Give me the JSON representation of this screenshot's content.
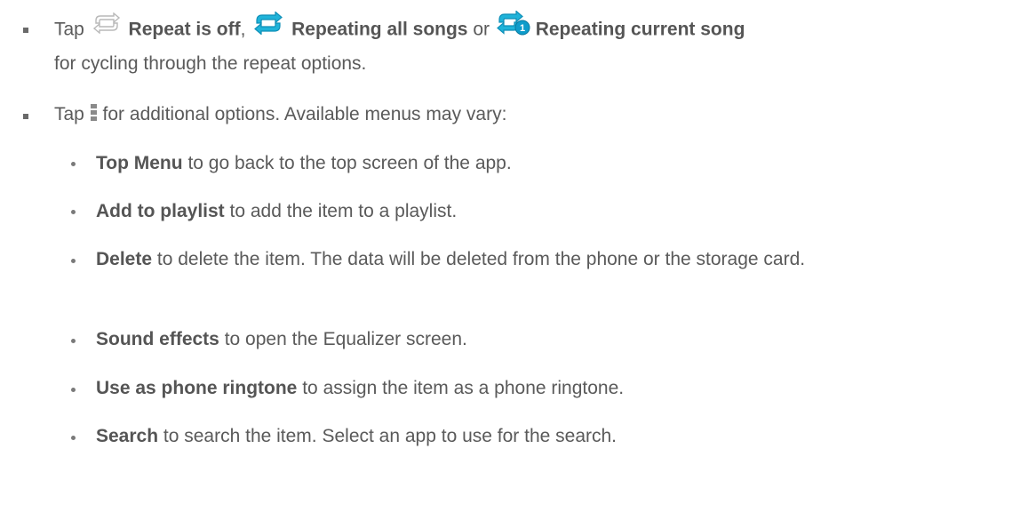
{
  "repeat_item": {
    "tap": "Tap",
    "off_label": "Repeat is off",
    "comma": ",",
    "all_label": "Repeating all songs",
    "or": "or",
    "current_label": "Repeating current song",
    "suffix": "for cycling through the repeat options.",
    "icons": {
      "off": "repeat-off-icon",
      "all": "repeat-all-icon",
      "current": "repeat-one-icon"
    },
    "colors": {
      "off_icon": "#b9b9b9",
      "active_icon": "#1fb3d9",
      "badge": "#0e9ccb"
    }
  },
  "options_item": {
    "tap": "Tap",
    "text": "for additional options. Available menus may vary:",
    "icon": "menu-overflow-icon"
  },
  "menu_options": [
    {
      "label": "Top Menu",
      "description": "to go back to the top screen of the app."
    },
    {
      "label": "Add to playlist",
      "description": "to add the item to a playlist."
    },
    {
      "label": "Delete",
      "description": "to delete the item. The data will be deleted from the phone or the storage card."
    },
    {
      "label": "Sound effects",
      "description": "to open the Equalizer screen."
    },
    {
      "label": "Use as phone ringtone",
      "description": "to assign the item as a phone ringtone."
    },
    {
      "label": "Search",
      "description": "to search the item. Select an app to use for the search."
    }
  ]
}
